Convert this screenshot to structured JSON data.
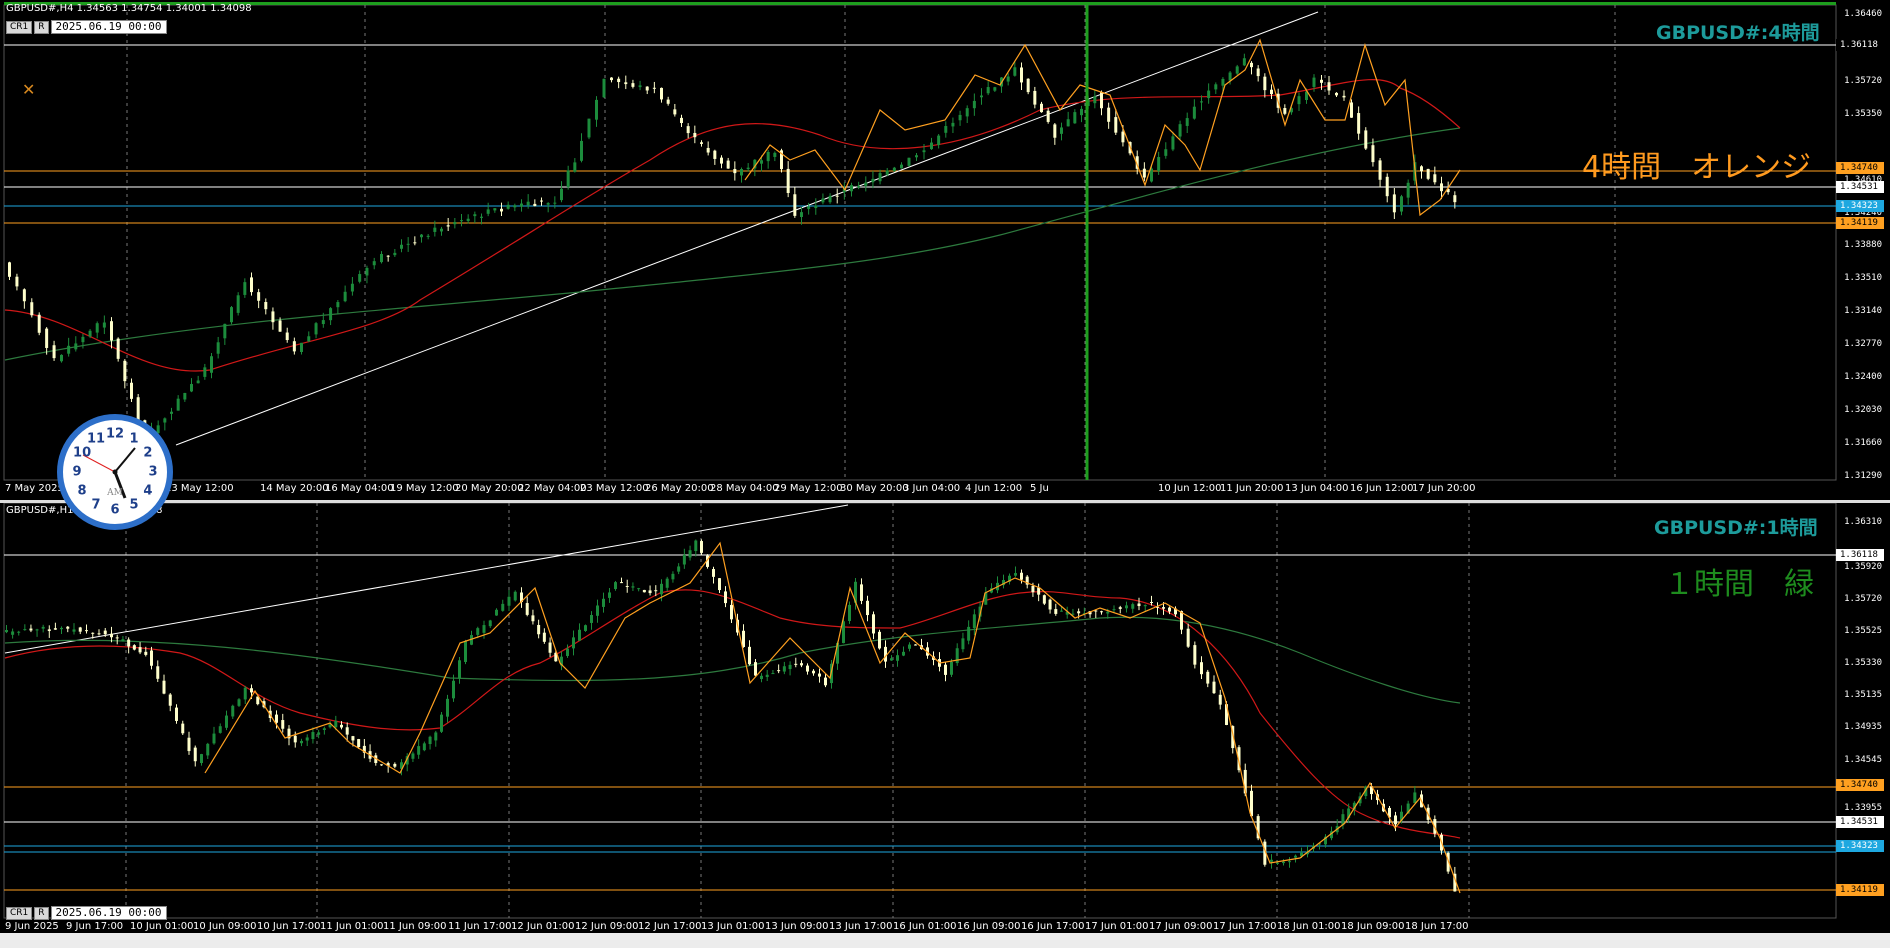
{
  "top_chart": {
    "title": "GBPUSD#,H4  1.34563 1.34754 1.34001 1.34098",
    "controls": [
      "CR1",
      "R"
    ],
    "datetime": "2025.06.19 00:00",
    "symbol_label": "GBPUSD#:4時間",
    "note": "4時間　オレンジ",
    "price_labels": [
      "1.36460",
      "1.35720",
      "1.35350",
      "1.34610",
      "1.34240",
      "1.33880",
      "1.33510",
      "1.33140",
      "1.32770",
      "1.32400",
      "1.32030",
      "1.31660",
      "1.31290"
    ],
    "price_tags": [
      {
        "text": "1.36118",
        "color": "#ffffff",
        "bg": "#000000"
      },
      {
        "text": "1.34740",
        "color": "#000000",
        "bg": "#ffa020"
      },
      {
        "text": "1.34531",
        "color": "#000000",
        "bg": "#ffffff"
      },
      {
        "text": "1.34323",
        "color": "#ffffff",
        "bg": "#1ea8e0"
      },
      {
        "text": "1.34119",
        "color": "#000000",
        "bg": "#ffa020"
      }
    ],
    "time_labels": [
      "7 May 2025",
      "13 May 12:00",
      "14 May 20:00",
      "16 May 04:00",
      "19 May 12:00",
      "20 May 20:00",
      "22 May 04:00",
      "23 May 12:00",
      "26 May 20:00",
      "28 May 04:00",
      "29 May 12:00",
      "30 May 20:00",
      "3 Jun 04:00",
      "4 Jun 12:00",
      "5 Ju",
      "10 Jun 12:00",
      "11 Jun 20:00",
      "13 Jun 04:00",
      "16 Jun 12:00",
      "17 Jun 20:00"
    ],
    "time_label_extra": "04:00"
  },
  "bottom_chart": {
    "title": "GBPUSD#,H1  1.34073 1.34098",
    "controls": [
      "CR1",
      "R"
    ],
    "datetime": "2025.06.19 00:00",
    "symbol_label": "GBPUSD#:1時間",
    "note": "１時間　緑",
    "price_labels": [
      "1.36310",
      "1.35920",
      "1.35720",
      "1.35525",
      "1.35330",
      "1.35135",
      "1.34935",
      "1.34545",
      "1.33955"
    ],
    "price_tags": [
      {
        "text": "1.36118",
        "color": "#000000",
        "bg": "#ffffff"
      },
      {
        "text": "1.34740",
        "color": "#000000",
        "bg": "#ffa020"
      },
      {
        "text": "1.34531",
        "color": "#000000",
        "bg": "#ffffff"
      },
      {
        "text": "1.34323",
        "color": "#ffffff",
        "bg": "#1ea8e0"
      },
      {
        "text": "1.34119",
        "color": "#000000",
        "bg": "#ffa020"
      }
    ],
    "time_labels": [
      "9 Jun 2025",
      "9 Jun 17:00",
      "10 Jun 01:00",
      "10 Jun 09:00",
      "10 Jun 17:00",
      "11 Jun 01:00",
      "11 Jun 09:00",
      "11 Jun 17:00",
      "12 Jun 01:00",
      "12 Jun 09:00",
      "12 Jun 17:00",
      "13 Jun 01:00",
      "13 Jun 09:00",
      "13 Jun 17:00",
      "16 Jun 01:00",
      "16 Jun 09:00",
      "16 Jun 17:00",
      "17 Jun 01:00",
      "17 Jun 09:00",
      "17 Jun 17:00",
      "18 Jun 01:00",
      "18 Jun 09:00",
      "18 Jun 17:00"
    ]
  },
  "clock": {
    "numbers": [
      "12",
      "1",
      "2",
      "3",
      "4",
      "5",
      "6",
      "7",
      "8",
      "9",
      "10",
      "11"
    ],
    "am_label": "AM"
  },
  "colors": {
    "background": "#000000",
    "bull_candle": "#1c8c3c",
    "bear_candle": "#ffffcc",
    "ma_fast": "#d01818",
    "ma_slow": "#2d7a3e",
    "zigzag": "#ffa020",
    "level_orange": "#ffa020",
    "level_white": "#ffffff",
    "level_blue": "#1ea8e0",
    "cursor_line": "#1e9e1e"
  }
}
